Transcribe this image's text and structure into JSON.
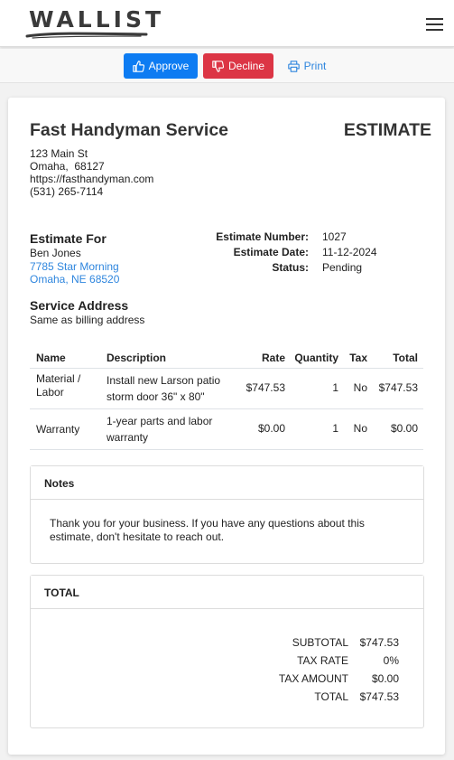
{
  "brand": {
    "logo_text": "WALLIST"
  },
  "toolbar": {
    "approve_label": "Approve",
    "decline_label": "Decline",
    "print_label": "Print"
  },
  "company": {
    "name": "Fast Handyman Service",
    "street": "123 Main St",
    "city_zip": "Omaha,  68127",
    "website": "https://fasthandyman.com",
    "phone": "(531) 265-7114"
  },
  "doc_type": "ESTIMATE",
  "estimate_for": {
    "heading": "Estimate For",
    "name": "Ben Jones",
    "street": "7785 Star Morning",
    "city": "Omaha, NE 68520"
  },
  "meta": {
    "number_label": "Estimate Number:",
    "number_value": "1027",
    "date_label": "Estimate Date:",
    "date_value": "11-12-2024",
    "status_label": "Status:",
    "status_value": "Pending"
  },
  "service_address": {
    "heading": "Service Address",
    "text": "Same as billing address"
  },
  "table": {
    "headers": {
      "name": "Name",
      "description": "Description",
      "rate": "Rate",
      "quantity": "Quantity",
      "tax": "Tax",
      "total": "Total"
    },
    "rows": [
      {
        "name": "Material / Labor",
        "description": "Install new Larson patio storm door 36\" x 80\"",
        "rate": "$747.53",
        "quantity": "1",
        "tax": "No",
        "total": "$747.53"
      },
      {
        "name": "Warranty",
        "description": "1-year parts and labor warranty",
        "rate": "$0.00",
        "quantity": "1",
        "tax": "No",
        "total": "$0.00"
      }
    ]
  },
  "notes": {
    "heading": "Notes",
    "text": "Thank you for your business. If you have any questions about this estimate, don't hesitate to reach out."
  },
  "totals": {
    "heading": "TOTAL",
    "subtotal_label": "SUBTOTAL",
    "subtotal_value": "$747.53",
    "tax_rate_label": "TAX RATE",
    "tax_rate_value": "0%",
    "tax_amount_label": "TAX AMOUNT",
    "tax_amount_value": "$0.00",
    "total_label": "TOTAL",
    "total_value": "$747.53"
  },
  "colors": {
    "approve": "#0d7cf2",
    "decline": "#dc3545",
    "link": "#2f86de"
  },
  "icons": {
    "approve": "thumbs-up-icon",
    "decline": "thumbs-down-icon",
    "print": "printer-icon",
    "menu": "hamburger-menu-icon"
  }
}
